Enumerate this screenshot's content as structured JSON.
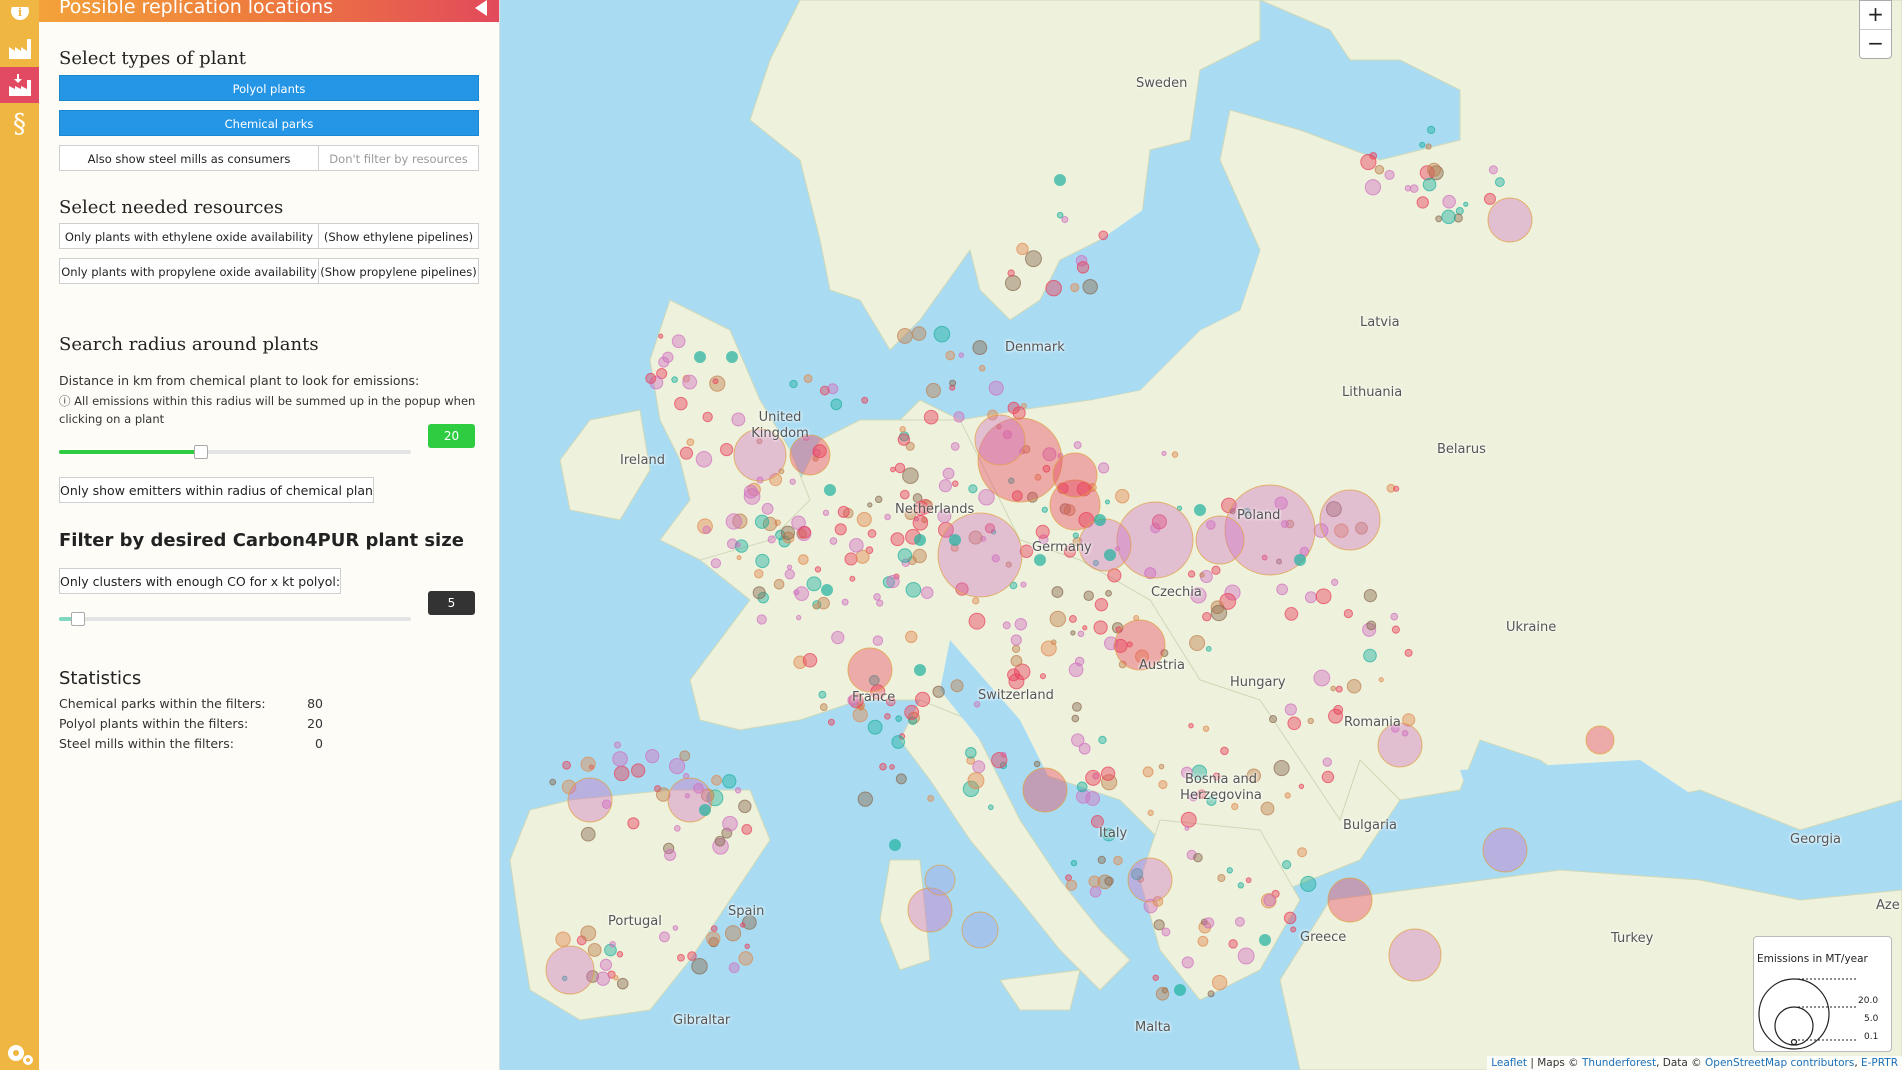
{
  "panel": {
    "header_title": "Possible replication locations",
    "plant_types": {
      "title": "Select types of plant",
      "polyol_label": "Polyol plants",
      "chemical_parks_label": "Chemical parks",
      "steel_mills_label": "Also show steel mills as consumers",
      "no_filter_label": "Don't filter by resources"
    },
    "resources": {
      "title": "Select needed resources",
      "ethylene_label": "Only plants with ethylene oxide availability",
      "ethylene_pipelines_label": "(Show ethylene pipelines)",
      "propylene_label": "Only plants with propylene oxide availability",
      "propylene_pipelines_label": "(Show propylene pipelines)"
    },
    "radius": {
      "title": "Search radius around plants",
      "description": "Distance in km from chemical plant to look for emissions:",
      "hint": "ⓘ All emissions within this radius will be summed up in the popup when clicking on a plant",
      "value": "20",
      "slider_fraction": 0.4,
      "emitters_button": "Only show emitters within radius of chemical plant"
    },
    "size_filter": {
      "title": "Filter by desired Carbon4PUR plant size",
      "button_label": "Only clusters with enough CO for x kt polyol:",
      "value": "5",
      "slider_fraction": 0.05
    },
    "statistics": {
      "title": "Statistics",
      "rows": [
        {
          "label": "Chemical parks within the filters:",
          "value": "80"
        },
        {
          "label": "Polyol plants within the filters:",
          "value": "20"
        },
        {
          "label": "Steel mills within the filters:",
          "value": "0"
        }
      ]
    }
  },
  "map": {
    "labels": [
      "Sweden",
      "Latvia",
      "Denmark",
      "Lithuania",
      "United Kingdom",
      "Belarus",
      "Ireland",
      "Poland",
      "Germany",
      "Netherlands",
      "Czechia",
      "Ukraine",
      "France",
      "Switzerland",
      "Austria",
      "Hungary",
      "Romania",
      "Bosnia and Herzegovina",
      "Bulgaria",
      "Italy",
      "Spain",
      "Portugal",
      "Georgia",
      "Greece",
      "Turkey",
      "Gibraltar",
      "Malta",
      "Aze"
    ],
    "zoom_in": "+",
    "zoom_out": "−",
    "legend": {
      "title": "Emissions in MT/year",
      "values": [
        "20.0",
        "5.0",
        "0.1"
      ]
    },
    "attribution": {
      "leaflet": "Leaflet",
      "sep1": " | Maps © ",
      "thunderforest": "Thunderforest",
      "sep2": ", Data © ",
      "osm": "OpenStreetMap contributors",
      "sep3": ", ",
      "eprtr": "E-PRTR"
    }
  },
  "colors": {
    "rail": "#f0b642",
    "active_rail": "#e24a62",
    "primary_button": "#2596e6",
    "radius_value": "#2ecc40",
    "size_value": "#333333",
    "emitter_red": "#e8405a",
    "emitter_pink": "#d070c0",
    "plant_teal": "#20b0a0"
  },
  "icons": [
    "info-icon",
    "factory-icon",
    "factory-download-icon",
    "paragraph-icon",
    "settings-gears-icon",
    "collapse-left-icon"
  ]
}
